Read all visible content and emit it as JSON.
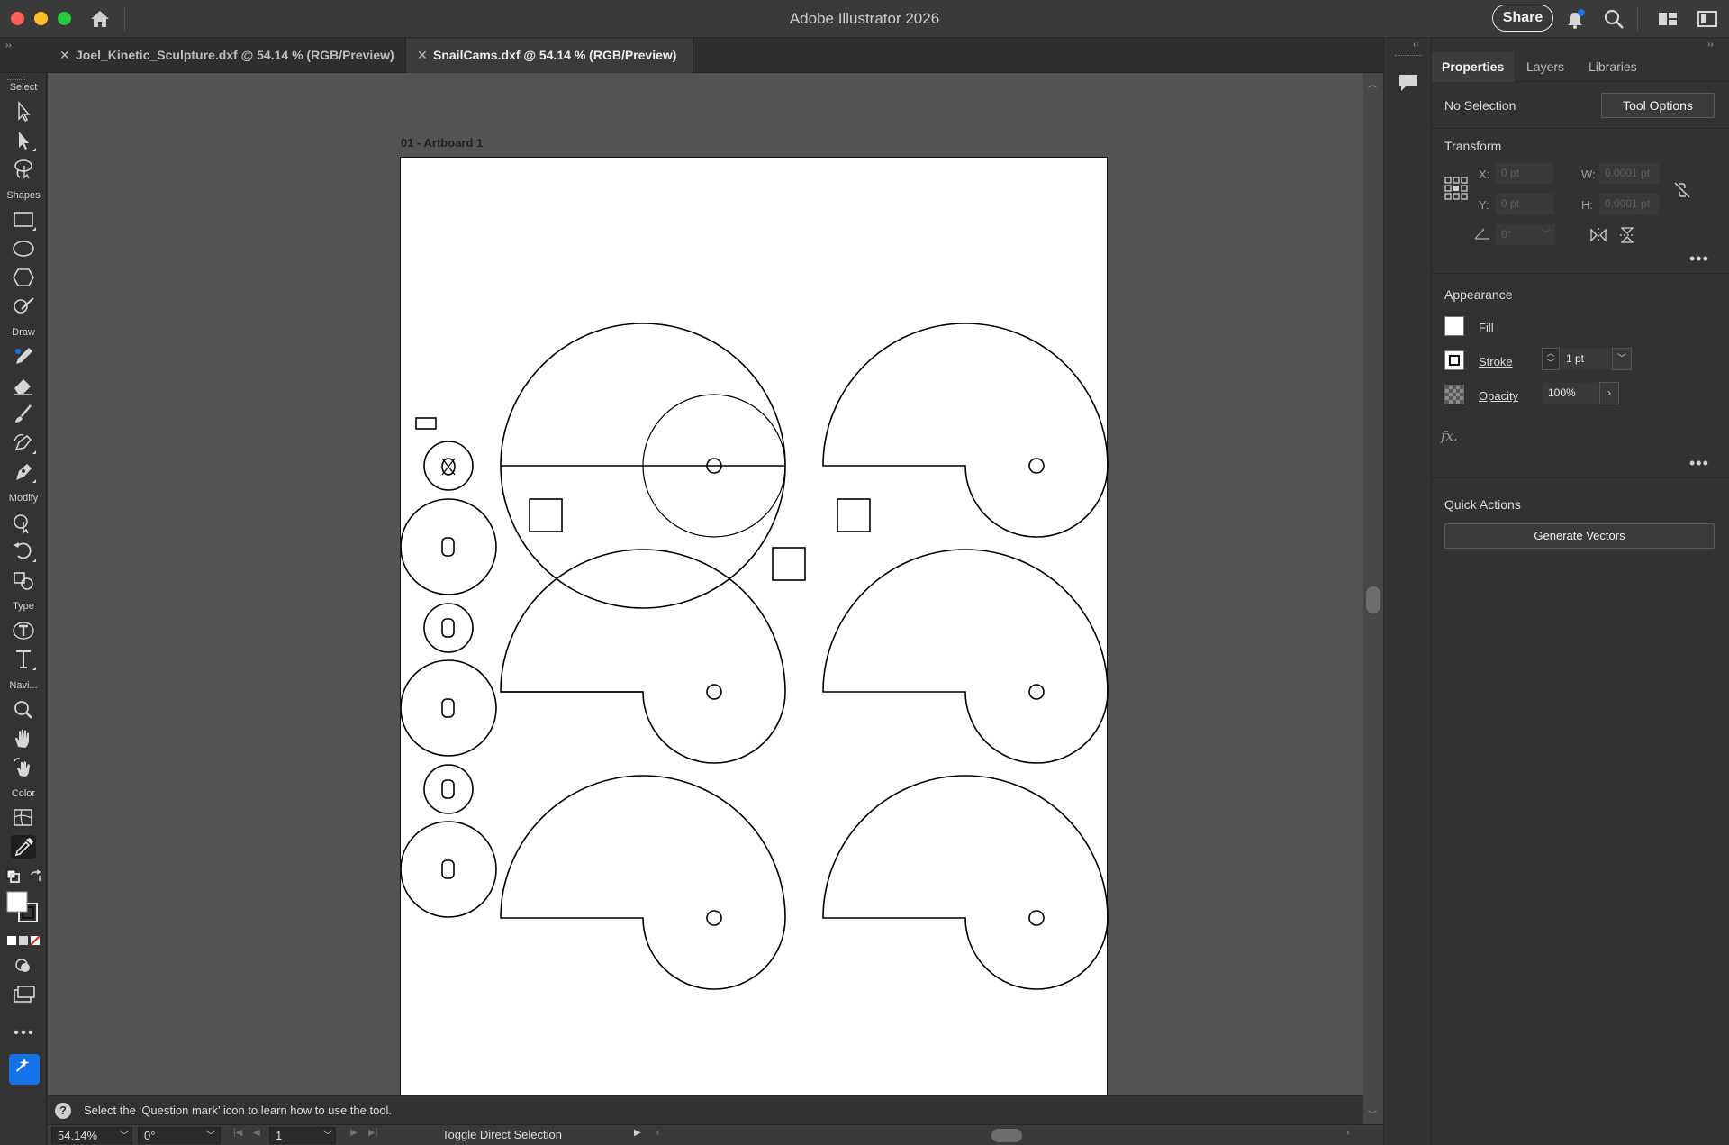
{
  "app": {
    "title": "Adobe Illustrator 2026",
    "share_label": "Share"
  },
  "tabs": [
    {
      "close": "✕",
      "label": "Joel_Kinetic_Sculpture.dxf @ 54.14 % (RGB/Preview)",
      "active": false
    },
    {
      "close": "✕",
      "label": "SnailCams.dxf @ 54.14 % (RGB/Preview)",
      "active": true
    }
  ],
  "toolbar": {
    "sections": {
      "select": "Select",
      "shapes": "Shapes",
      "draw": "Draw",
      "modify": "Modify",
      "type": "Type",
      "navigate": "Navi...",
      "color": "Color"
    }
  },
  "canvas": {
    "artboard_label": "01 - Artboard 1"
  },
  "hint": {
    "icon": "?",
    "text": "Select the ‘Question mark’ icon to learn how to use the tool."
  },
  "status": {
    "zoom": "54.14%",
    "rotation": "0°",
    "artboard_number": "1",
    "tool_status": "Toggle Direct Selection"
  },
  "panel": {
    "tabs": {
      "properties": "Properties",
      "layers": "Layers",
      "libraries": "Libraries"
    },
    "selection": "No Selection",
    "tool_options_label": "Tool Options",
    "transform": {
      "title": "Transform",
      "x_label": "X:",
      "x_value": "0 pt",
      "y_label": "Y:",
      "y_value": "0 pt",
      "w_label": "W:",
      "w_value": "0.0001 pt",
      "h_label": "H:",
      "h_value": "0.0001 pt",
      "angle_value": "0°"
    },
    "appearance": {
      "title": "Appearance",
      "fill_label": "Fill",
      "stroke_label": "Stroke",
      "stroke_weight": "1 pt",
      "opacity_label": "Opacity",
      "opacity_value": "100%",
      "fx_label": "fx."
    },
    "quick_actions": {
      "title": "Quick Actions",
      "generate_label": "Generate Vectors"
    },
    "more": "•••"
  },
  "colors": {
    "accent": "#1473e6",
    "panel_bg": "#323232",
    "canvas_bg": "#535353",
    "artboard": "#ffffff"
  }
}
